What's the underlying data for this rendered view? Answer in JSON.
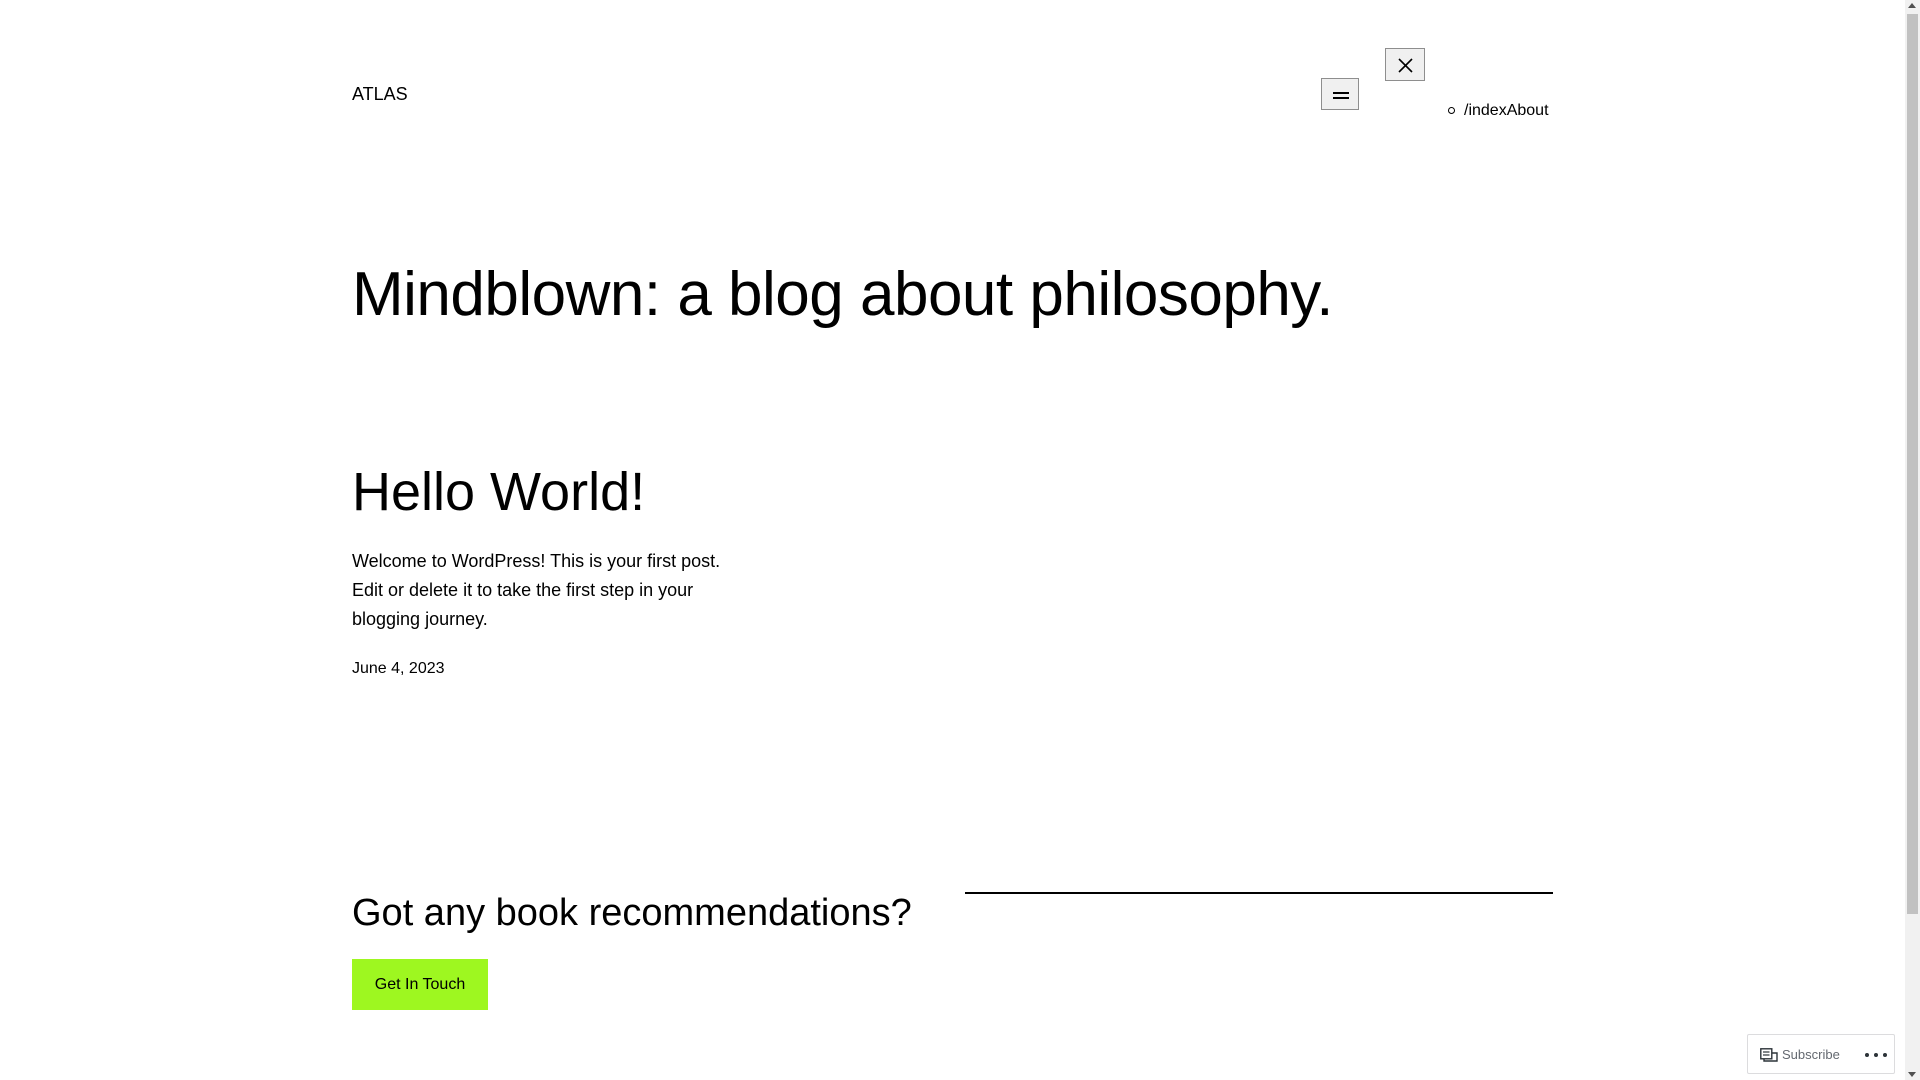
{
  "header": {
    "site_title": "ATLAS",
    "open_menu_icon": "hamburger-icon",
    "close_menu_icon": "close-icon",
    "nav": {
      "items": [
        {
          "label": "/index",
          "bullet": "circle"
        },
        {
          "label": "About"
        }
      ]
    }
  },
  "hero": {
    "heading": "Mindblown: a blog about philosophy."
  },
  "post": {
    "title": "Hello World!",
    "excerpt": "Welcome to WordPress! This is your first post. Edit or delete it to take the first step in your blogging journey.",
    "date": "June 4, 2023"
  },
  "cta": {
    "heading": "Got any book recommendations?",
    "button_label": "Get In Touch",
    "button_color": "#9ef720"
  },
  "subscribe_widget": {
    "label": "Subscribe",
    "icon": "reader-icon",
    "more_icon": "ellipsis-icon"
  }
}
